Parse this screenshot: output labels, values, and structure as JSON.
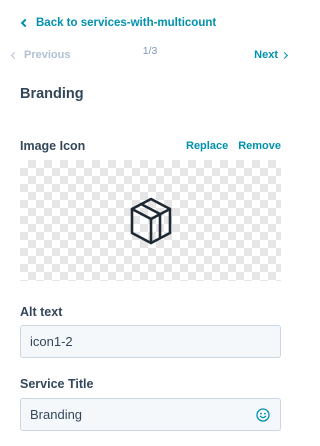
{
  "nav": {
    "back_label": "Back to services-with-multicount"
  },
  "pager": {
    "previous_label": "Previous",
    "counter": "1/3",
    "next_label": "Next"
  },
  "section": {
    "title": "Branding"
  },
  "image_field": {
    "label": "Image Icon",
    "replace_label": "Replace",
    "remove_label": "Remove",
    "icon": "cube-icon"
  },
  "alt_text": {
    "label": "Alt text",
    "value": "icon1-2"
  },
  "service_title": {
    "label": "Service Title",
    "value": "Branding",
    "icon": "emoji-icon"
  },
  "colors": {
    "link": "#0091ae",
    "text": "#33475b",
    "disabled": "#b0c1d4",
    "field_bg": "#f5f8fa",
    "field_border": "#cbd6e2"
  }
}
